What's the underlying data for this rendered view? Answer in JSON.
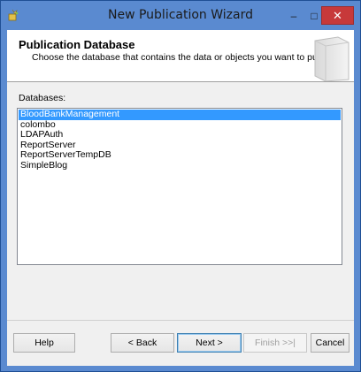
{
  "window": {
    "title": "New Publication Wizard",
    "minimize_glyph": "–",
    "maximize_glyph": "□",
    "close_glyph": "✕"
  },
  "header": {
    "title": "Publication Database",
    "description": "Choose the database that contains the data or objects you want to publish."
  },
  "databases": {
    "label": "Databases:",
    "items": [
      {
        "name": "BloodBankManagement",
        "selected": true
      },
      {
        "name": "colombo",
        "selected": false
      },
      {
        "name": "LDAPAuth",
        "selected": false
      },
      {
        "name": "ReportServer",
        "selected": false
      },
      {
        "name": "ReportServerTempDB",
        "selected": false
      },
      {
        "name": "SimpleBlog",
        "selected": false
      }
    ]
  },
  "buttons": {
    "help": "Help",
    "back": "< Back",
    "next": "Next >",
    "finish": "Finish >>|",
    "cancel": "Cancel"
  },
  "colors": {
    "titlebar": "#5a8ad0",
    "close": "#c7393a",
    "selection": "#3399ff"
  }
}
